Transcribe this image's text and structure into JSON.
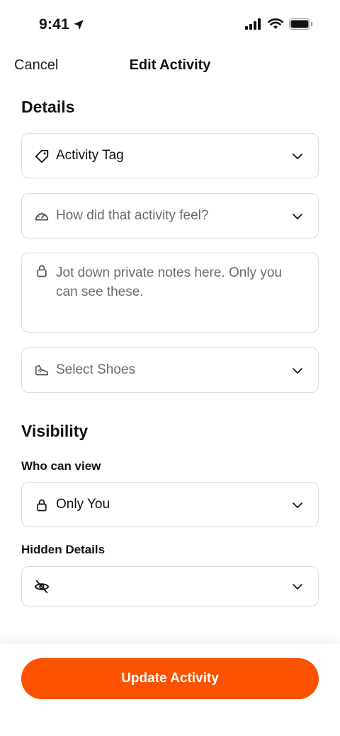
{
  "status_bar": {
    "time": "9:41"
  },
  "nav": {
    "cancel": "Cancel",
    "title": "Edit Activity"
  },
  "details": {
    "title": "Details",
    "activity_tag": "Activity Tag",
    "feel_placeholder": "How did that activity feel?",
    "notes_placeholder": "Jot down private notes here. Only you can see these.",
    "shoes_placeholder": "Select Shoes"
  },
  "visibility": {
    "title": "Visibility",
    "who_can_view_label": "Who can view",
    "who_can_view_value": "Only You",
    "hidden_details_label": "Hidden Details"
  },
  "footer": {
    "update_button": "Update Activity"
  },
  "colors": {
    "accent": "#fc5200",
    "border": "#dcdcdc",
    "placeholder": "#6b6b6b"
  }
}
